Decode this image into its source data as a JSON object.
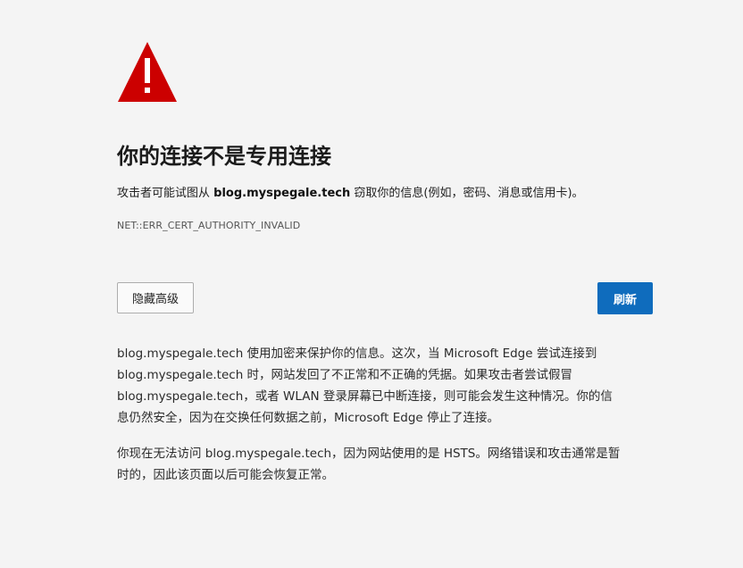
{
  "error_page": {
    "title": "你的连接不是专用连接",
    "description": {
      "prefix": "攻击者可能试图从 ",
      "host": "blog.myspegale.tech",
      "suffix": " 窃取你的信息(例如，密码、消息或信用卡)。"
    },
    "error_code": "NET::ERR_CERT_AUTHORITY_INVALID",
    "buttons": {
      "advanced_label": "隐藏高级",
      "refresh_label": "刷新"
    },
    "details": {
      "paragraph1": [
        "blog.myspegale.tech 使用加密来保护你的信息。这次，当 Microsoft Edge 尝试连接到",
        "blog.myspegale.tech 时，网站发回了不正常和不正确的凭据。如果攻击者尝试假冒",
        "blog.myspegale.tech，或者 WLAN 登录屏幕已中断连接，则可能会发生这种情况。你的信",
        "息仍然安全，因为在交换任何数据之前，Microsoft Edge 停止了连接。"
      ],
      "paragraph2": [
        "你现在无法访问 blog.myspegale.tech，因为网站使用的是 HSTS。网络错误和攻击通常是暂",
        "时的，因此该页面以后可能会恢复正常。"
      ]
    },
    "colors": {
      "background": "#f4f4f4",
      "warning_red": "#cc0000",
      "primary_button": "#0f6cbd"
    },
    "icons": {
      "warning": "warning-triangle-icon"
    }
  }
}
